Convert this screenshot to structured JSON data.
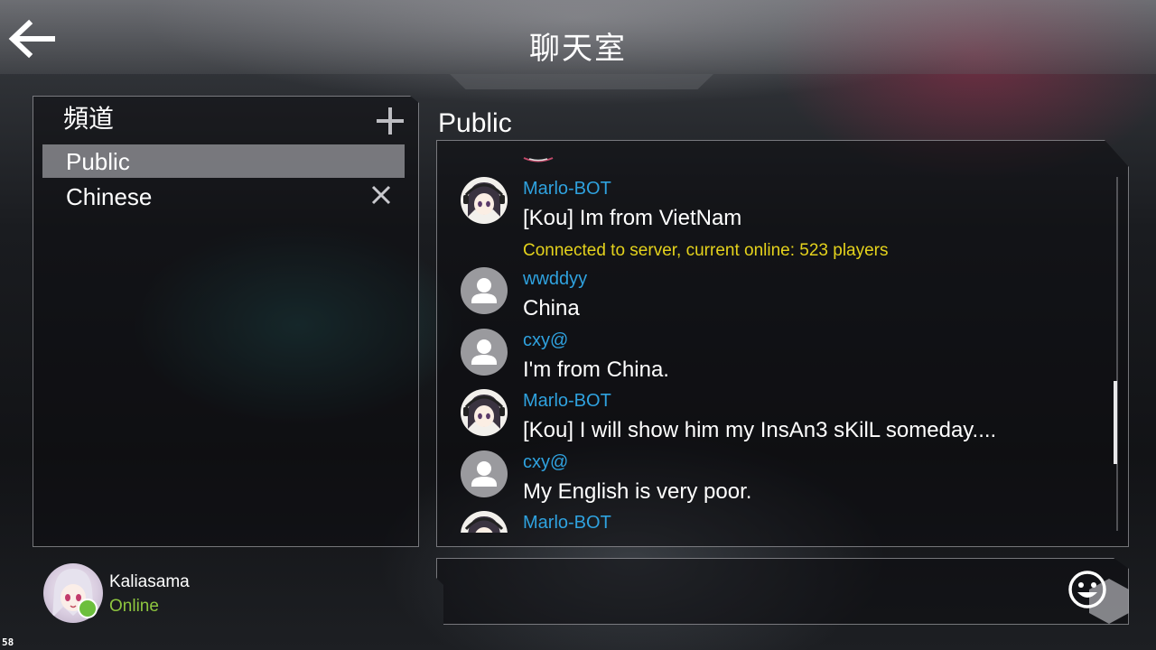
{
  "header": {
    "title": "聊天室",
    "back_icon": "back-arrow-icon"
  },
  "channels": {
    "heading": "頻道",
    "add_icon": "plus-icon",
    "close_icon": "close-icon",
    "items": [
      {
        "label": "Public",
        "active": true
      },
      {
        "label": "Chinese",
        "active": false
      }
    ]
  },
  "profile": {
    "name": "Kaliasama",
    "status": "Online",
    "status_color": "#8ec63f"
  },
  "chat": {
    "channel_title": "Public",
    "messages": [
      {
        "author": "Marlo-BOT",
        "text": "[Kou] Im from VietNam",
        "avatar": "bot"
      },
      {
        "system": "Connected to server, current online: 523 players"
      },
      {
        "author": "wwddyy",
        "text": "China",
        "avatar": "default"
      },
      {
        "author": "cxy@",
        "text": "I'm from China.",
        "avatar": "default"
      },
      {
        "author": "Marlo-BOT",
        "text": "[Kou] I will show him my InsAn3 sKilL someday....",
        "avatar": "bot"
      },
      {
        "author": "cxy@",
        "text": "My English is very poor.",
        "avatar": "default"
      },
      {
        "author": "Marlo-BOT",
        "text": "",
        "avatar": "bot"
      }
    ]
  },
  "input": {
    "placeholder": "",
    "value": "",
    "emoji_icon": "smiley-icon"
  },
  "colors": {
    "author": "#2fa2df",
    "system": "#e4d21c",
    "accent_panel_border": "#c8c8cd"
  },
  "debug": {
    "fps": "58"
  }
}
